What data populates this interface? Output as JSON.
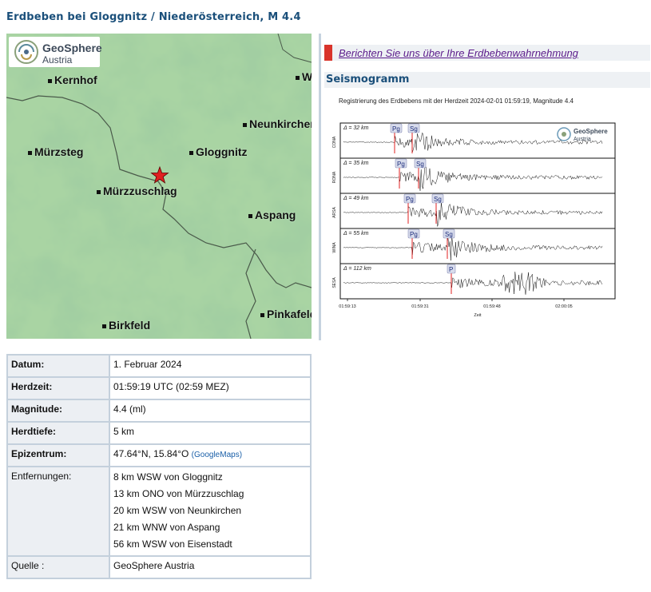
{
  "title": "Erdbeben bei Gloggnitz / Niederösterreich, M 4.4",
  "map": {
    "logo_line1": "GeoSphere",
    "logo_line2": "Austria",
    "towns": [
      {
        "name": "Kernhof"
      },
      {
        "name": "Neunkirchen"
      },
      {
        "name": "Mürzsteg"
      },
      {
        "name": "Gloggnitz"
      },
      {
        "name": "Mürzzuschlag"
      },
      {
        "name": "Aspang"
      },
      {
        "name": "Pinkafeld"
      },
      {
        "name": "Birkfeld"
      },
      {
        "name": "Wiener Neustadt"
      }
    ],
    "epicenter_marker": "red-star"
  },
  "report_link": "Berichten Sie uns über Ihre Erdbebenwahrnehmung",
  "seismogram": {
    "heading": "Seismogramm",
    "caption": "Registrierung des Erdbebens mit der Herdzeit 2024-02-01 01:59:19, Magnitude 4.4",
    "logo_line1": "GeoSphere",
    "logo_line2": "Austria",
    "x_label": "Zeit",
    "x_ticks": [
      "01:59:13",
      "01:59:31",
      "01:59:48",
      "02:00:05"
    ],
    "traces": [
      {
        "station": "CONA",
        "distance": "Δ = 32 km",
        "phases": [
          "Pg",
          "Sg"
        ]
      },
      {
        "station": "RONA",
        "distance": "Δ = 35 km",
        "phases": [
          "Pg",
          "Sg"
        ]
      },
      {
        "station": "ARSA",
        "distance": "Δ = 49 km",
        "phases": [
          "Pg",
          "Sg"
        ]
      },
      {
        "station": "WINA",
        "distance": "Δ = 55 km",
        "phases": [
          "Pg",
          "Sg"
        ]
      },
      {
        "station": "SESA",
        "distance": "Δ = 112 km",
        "phases": [
          "P"
        ]
      }
    ]
  },
  "table": {
    "datum_label": "Datum:",
    "datum": "1. Februar 2024",
    "herdzeit_label": "Herdzeit:",
    "herdzeit": "01:59:19 UTC (02:59 MEZ)",
    "magnitude_label": "Magnitude:",
    "magnitude": "4.4 (ml)",
    "herdtiefe_label": "Herdtiefe:",
    "herdtiefe": "5 km",
    "epizentrum_label": "Epizentrum:",
    "epizentrum": "47.64°N, 15.84°O",
    "googlemaps": "(GoogleMaps)",
    "entfernungen_label": "Entfernungen:",
    "entfernungen": [
      "8 km WSW von Gloggnitz",
      "13 km ONO von Mürzzuschlag",
      "20 km WSW von Neunkirchen",
      "21 km WNW von Aspang",
      "56 km WSW von Eisenstadt"
    ],
    "quelle_label": "Quelle :",
    "quelle": "GeoSphere Austria"
  }
}
